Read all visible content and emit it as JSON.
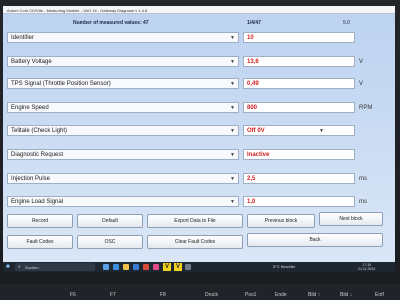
{
  "window": {
    "title": "Autom Com CDS/ite - Measuring Module - VAG 16 - Gateway Diagnose v 1.4.8"
  },
  "header": {
    "count_label": "Number of measured values: 47",
    "page": "1/4/47",
    "version": "5.0"
  },
  "rows": [
    {
      "label": "Identifier",
      "value": "10",
      "unit": "",
      "dropdown": false
    },
    {
      "label": "Battery Voltage",
      "value": "13,6",
      "unit": "V",
      "dropdown": false
    },
    {
      "label": "TPS Signal (Throttle Position Sensor)",
      "value": "0,49",
      "unit": "V",
      "dropdown": false
    },
    {
      "label": "Engine Speed",
      "value": "800",
      "unit": "RPM",
      "dropdown": false
    },
    {
      "label": "Telltale (Check Light)",
      "value": "Off  0V",
      "unit": "",
      "dropdown": true
    },
    {
      "label": "Diagnostic Request",
      "value": "Inactive",
      "unit": "",
      "dropdown": false
    },
    {
      "label": "Injection Pulse",
      "value": "2,5",
      "unit": "ms",
      "dropdown": false
    },
    {
      "label": "Engine Load Signal",
      "value": "1,0",
      "unit": "ms",
      "dropdown": false
    }
  ],
  "buttons": {
    "record": "Record",
    "default": "Default",
    "export": "Export Data to File",
    "previous": "Previous block",
    "next": "Next block",
    "fault_codes": "Fault Codes",
    "osc": "OSC",
    "clear_fault": "Clear Fault Codes",
    "back": "Back"
  },
  "taskbar": {
    "search_placeholder": "Suchen",
    "weather": "5°C  Bewölkt",
    "time": "17:15",
    "date": "21.11.2024",
    "v_label": "V"
  },
  "keyboard": {
    "keys": [
      "F6",
      "F7",
      "F8",
      "Druck",
      "Pos1",
      "Ende",
      "Bild ↑",
      "Bild ↓",
      "Entf"
    ]
  },
  "colors": {
    "value_text": "#d02020",
    "app_bg": "#c8d9f2"
  }
}
